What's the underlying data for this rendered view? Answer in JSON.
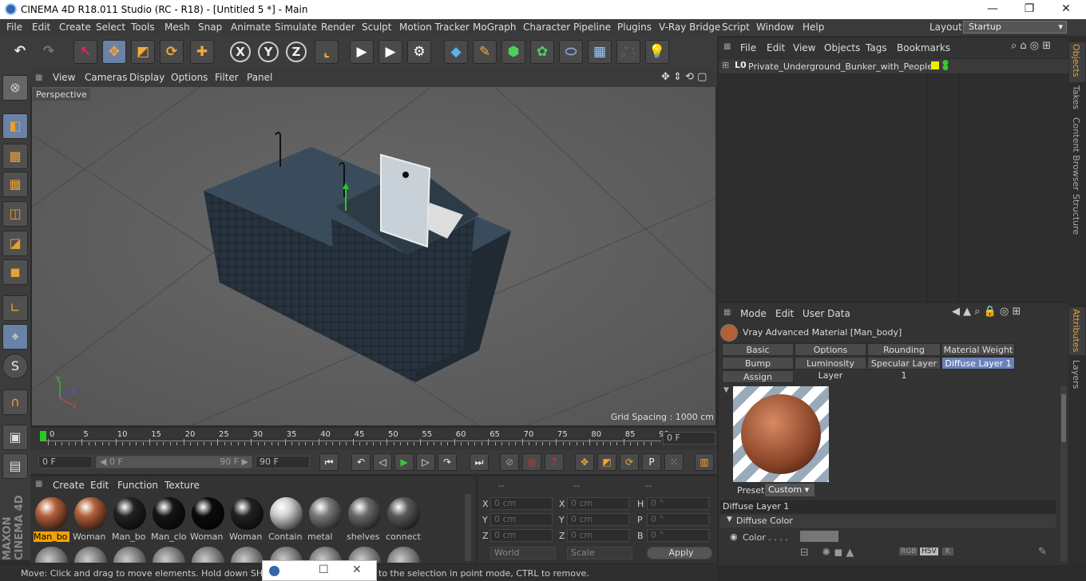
{
  "window": {
    "title": "CINEMA 4D R18.011 Studio (RC - R18) - [Untitled 5 *] - Main",
    "minimize": "—",
    "maximize": "❐",
    "close": "✕"
  },
  "menubar": {
    "items": [
      "File",
      "Edit",
      "Create",
      "Select",
      "Tools",
      "Mesh",
      "Snap",
      "Animate",
      "Simulate",
      "Render",
      "Sculpt",
      "Motion Tracker",
      "MoGraph",
      "Character",
      "Pipeline",
      "Plugins",
      "V-Ray Bridge",
      "Script",
      "Window",
      "Help"
    ],
    "layout_label": "Layout:",
    "layout_value": "Startup"
  },
  "viewport": {
    "menu": [
      "View",
      "Cameras",
      "Display",
      "Options",
      "Filter",
      "Panel"
    ],
    "camera_label": "Perspective",
    "grid_spacing": "Grid Spacing : 1000 cm",
    "axis_y": "Y",
    "axis_z": "Z",
    "axis_x": "X"
  },
  "timeline": {
    "ticks": [
      "0",
      "5",
      "10",
      "15",
      "20",
      "25",
      "30",
      "35",
      "40",
      "45",
      "50",
      "55",
      "60",
      "65",
      "70",
      "75",
      "80",
      "85",
      "90"
    ],
    "current_frame": "0 F",
    "start_field": "0 F",
    "range_start": "◀ 0 F",
    "range_end": "90 F ▶",
    "end_field": "90 F"
  },
  "material_manager": {
    "menu": [
      "Create",
      "Edit",
      "Function",
      "Texture"
    ],
    "materials": [
      {
        "name": "Man_bo",
        "color": "#b2603a",
        "selected": true
      },
      {
        "name": "Woman",
        "color": "#b2603a"
      },
      {
        "name": "Man_bo",
        "color": "#222"
      },
      {
        "name": "Man_clo",
        "color": "#151515"
      },
      {
        "name": "Woman",
        "color": "#0b0b0b"
      },
      {
        "name": "Woman",
        "color": "#222"
      },
      {
        "name": "Contain",
        "color": "#cfcfcf"
      },
      {
        "name": "metal",
        "color": "#7a7a7a"
      },
      {
        "name": "shelves",
        "color": "#6a6a6a"
      },
      {
        "name": "connect",
        "color": "#5a5a5a"
      }
    ]
  },
  "coordinates": {
    "header": [
      "--",
      "--",
      "--"
    ],
    "rows": [
      {
        "l1": "X",
        "v1": "0 cm",
        "l2": "X",
        "v2": "0 cm",
        "l3": "H",
        "v3": "0 °"
      },
      {
        "l1": "Y",
        "v1": "0 cm",
        "l2": "Y",
        "v2": "0 cm",
        "l3": "P",
        "v3": "0 °"
      },
      {
        "l1": "Z",
        "v1": "0 cm",
        "l2": "Z",
        "v2": "0 cm",
        "l3": "B",
        "v3": "0 °"
      }
    ],
    "space": "World",
    "mode": "Scale",
    "apply": "Apply"
  },
  "status": {
    "text_left": "Move: Click and drag to move elements. Hold down SHIFT",
    "text_right": "to the selection in point mode, CTRL to remove."
  },
  "object_manager": {
    "menu": [
      "File",
      "Edit",
      "View",
      "Objects",
      "Tags",
      "Bookmarks"
    ],
    "objects": [
      {
        "name": "Private_Underground_Bunker_with_People"
      }
    ]
  },
  "attributes": {
    "menu": [
      "Mode",
      "Edit",
      "User Data"
    ],
    "material_title": "Vray Advanced Material [Man_body]",
    "tabs": [
      "Basic",
      "Options",
      "Rounding",
      "Material Weight",
      "Bump",
      "Luminosity Layer",
      "Specular Layer 1",
      "Diffuse Layer 1",
      "Assign"
    ],
    "active_tab": "Diffuse Layer 1",
    "preset_label": "Preset",
    "preset_value": "Custom",
    "section": "Diffuse Layer 1",
    "subsection": "Diffuse Color",
    "color_label": "Color . . . .",
    "modes": [
      "RGB",
      "HSV",
      "K"
    ]
  },
  "side_tabs": [
    "Objects",
    "Takes",
    "Content Browser",
    "Structure",
    "Attributes",
    "Layers"
  ],
  "brand": {
    "line1": "MAXON",
    "line2": "CINEMA 4D"
  }
}
